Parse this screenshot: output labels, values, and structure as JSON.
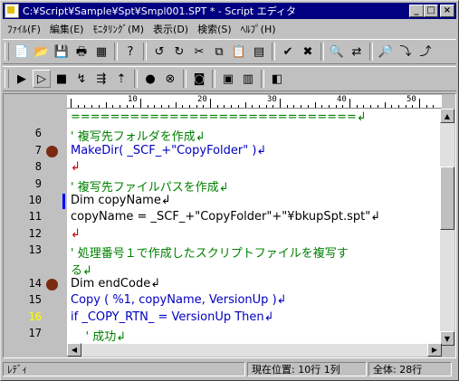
{
  "window": {
    "title": "C:¥Script¥Sample¥Spt¥Smpl001.SPT * - Script エディタ"
  },
  "menus": [
    "ﾌｧｲﾙ(F)",
    "編集(E)",
    "ﾓﾆﾀﾘﾝｸﾞ(M)",
    "表示(D)",
    "検索(S)",
    "ﾍﾙﾌﾟ(H)"
  ],
  "toolbar1": [
    {
      "name": "new-file-icon",
      "glyph": "📄"
    },
    {
      "name": "open-file-icon",
      "glyph": "📂"
    },
    {
      "name": "save-icon",
      "glyph": "💾"
    },
    {
      "name": "print-icon",
      "glyph": "🖶"
    },
    {
      "name": "properties-icon",
      "glyph": "▦"
    },
    {
      "sep": true
    },
    {
      "name": "help-icon",
      "glyph": "?"
    },
    {
      "sep": true
    },
    {
      "name": "undo-icon",
      "glyph": "↺"
    },
    {
      "name": "redo-icon",
      "glyph": "↻"
    },
    {
      "name": "cut-icon",
      "glyph": "✂"
    },
    {
      "name": "copy-icon",
      "glyph": "⧉"
    },
    {
      "name": "paste-icon",
      "glyph": "📋"
    },
    {
      "name": "select-all-icon",
      "glyph": "▤"
    },
    {
      "sep": true
    },
    {
      "name": "check-icon",
      "glyph": "✔"
    },
    {
      "name": "stop-check-icon",
      "glyph": "✖"
    },
    {
      "sep": true
    },
    {
      "name": "find-icon",
      "glyph": "🔍"
    },
    {
      "name": "replace-icon",
      "glyph": "⇄"
    },
    {
      "sep": true
    },
    {
      "name": "zoom-icon",
      "glyph": "🔎"
    },
    {
      "name": "find-next-icon",
      "glyph": "⤵"
    },
    {
      "name": "find-prev-icon",
      "glyph": "⤴"
    }
  ],
  "toolbar2": [
    {
      "name": "run-icon",
      "glyph": "▶"
    },
    {
      "name": "run-to-cursor-icon",
      "glyph": "▷"
    },
    {
      "name": "stop-icon",
      "glyph": "■"
    },
    {
      "name": "step-icon",
      "glyph": "↯"
    },
    {
      "name": "step-over-icon",
      "glyph": "⇶"
    },
    {
      "name": "step-out-icon",
      "glyph": "⇡"
    },
    {
      "sep": true
    },
    {
      "name": "set-breakpoint-icon",
      "glyph": "●"
    },
    {
      "name": "clear-breakpoint-icon",
      "glyph": "⊗"
    },
    {
      "sep": true
    },
    {
      "name": "watch-icon",
      "glyph": "◙"
    },
    {
      "sep": true
    },
    {
      "name": "variables-icon",
      "glyph": "▣"
    },
    {
      "name": "callstack-icon",
      "glyph": "▥"
    },
    {
      "sep": true
    },
    {
      "name": "monitor-icon",
      "glyph": "◧"
    }
  ],
  "ruler": {
    "labels": [
      "10",
      "20",
      "30",
      "40",
      "50"
    ]
  },
  "lines": [
    {
      "num": "",
      "bp": false,
      "cur": false,
      "text": "=============================↲",
      "color": "#008000"
    },
    {
      "num": "6",
      "bp": false,
      "cur": false,
      "text": "' 複写先フォルダを作成↲",
      "color": "#008000"
    },
    {
      "num": "7",
      "bp": true,
      "cur": false,
      "text": "MakeDir( _SCF_+\"CopyFolder\" )↲",
      "color": "#0000c0"
    },
    {
      "num": "8",
      "bp": false,
      "cur": false,
      "text": "↲",
      "color": "#c00000"
    },
    {
      "num": "9",
      "bp": false,
      "cur": false,
      "text": "' 複写先ファイルパスを作成↲",
      "color": "#008000"
    },
    {
      "num": "10",
      "bp": false,
      "cur": true,
      "text": "Dim copyName↲",
      "color": "#000000"
    },
    {
      "num": "11",
      "bp": false,
      "cur": false,
      "text": "copyName = _SCF_+\"CopyFolder\"+\"¥bkupSpt.spt\"↲",
      "color": "#000000"
    },
    {
      "num": "12",
      "bp": false,
      "cur": false,
      "text": "↲",
      "color": "#c00000"
    },
    {
      "num": "13",
      "bp": false,
      "cur": false,
      "text": "' 処理番号１で作成したスクリプトファイルを複写す",
      "color": "#008000"
    },
    {
      "num": "",
      "bp": false,
      "cur": false,
      "text": "る↲",
      "color": "#008000"
    },
    {
      "num": "14",
      "bp": true,
      "cur": false,
      "text": "Dim endCode↲",
      "color": "#000000"
    },
    {
      "num": "15",
      "bp": false,
      "cur": false,
      "text": "Copy ( %1, copyName, VersionUp )↲",
      "color": "#0000c0"
    },
    {
      "num": "16",
      "bp": false,
      "cur": false,
      "text": "if _COPY_RTN_ = VersionUp Then↲",
      "color": "#0000c0",
      "numColor": "#ffff00"
    },
    {
      "num": "17",
      "bp": false,
      "cur": false,
      "text": "    ' 成功↲",
      "color": "#008000"
    }
  ],
  "status": {
    "mode": "ﾚﾃﾞｨ",
    "position": "現在位置:  10行  1列",
    "total": "全体:  28行"
  }
}
